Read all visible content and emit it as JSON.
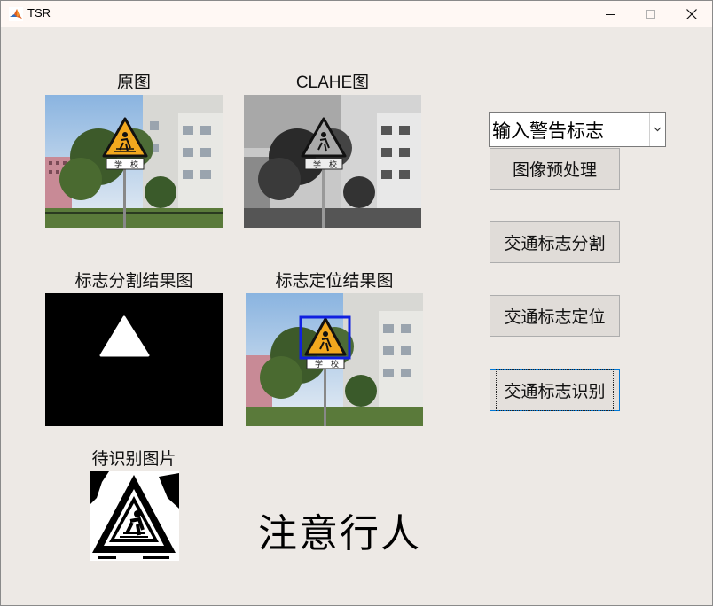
{
  "window": {
    "title": "TSR",
    "icon": "matlab-icon",
    "controls": [
      "minimize-icon",
      "maximize-icon",
      "close-icon"
    ]
  },
  "images": {
    "original_label": "原图",
    "clahe_label": "CLAHE图",
    "segment_label": "标志分割结果图",
    "locate_label": "标志定位结果图",
    "to_recognize_label": "待识别图片",
    "sign_text_left": "学",
    "sign_text_right": "校"
  },
  "controls": {
    "dropdown_value": "输入警告标志",
    "buttons": [
      {
        "label": "图像预处理"
      },
      {
        "label": "交通标志分割"
      },
      {
        "label": "交通标志定位"
      },
      {
        "label": "交通标志识别"
      }
    ]
  },
  "result": {
    "text": "注意行人"
  }
}
